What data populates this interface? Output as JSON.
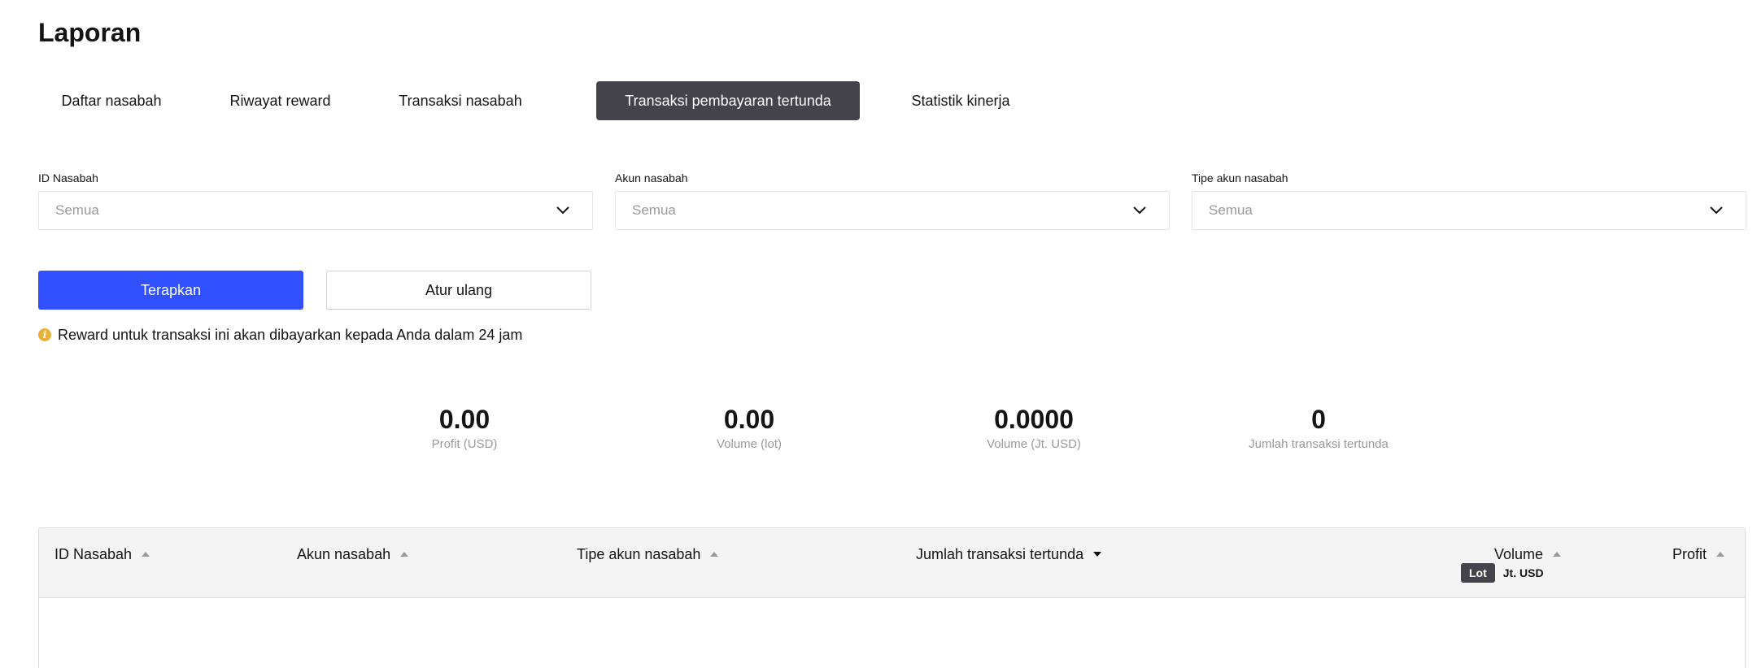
{
  "page": {
    "title": "Laporan"
  },
  "tabs": [
    {
      "label": "Daftar nasabah",
      "active": false
    },
    {
      "label": "Riwayat reward",
      "active": false
    },
    {
      "label": "Transaksi nasabah",
      "active": false
    },
    {
      "label": "Transaksi pembayaran tertunda",
      "active": true
    },
    {
      "label": "Statistik kinerja",
      "active": false
    }
  ],
  "filters": [
    {
      "label": "ID Nasabah",
      "value": "Semua"
    },
    {
      "label": "Akun nasabah",
      "value": "Semua"
    },
    {
      "label": "Tipe akun nasabah",
      "value": "Semua"
    }
  ],
  "actions": {
    "apply_label": "Terapkan",
    "reset_label": "Atur ulang"
  },
  "notice": {
    "icon": "info-icon",
    "text": "Reward untuk transaksi ini akan dibayarkan kepada Anda dalam 24 jam"
  },
  "stats": [
    {
      "value": "0.00",
      "label": "Profit (USD)"
    },
    {
      "value": "0.00",
      "label": "Volume (lot)"
    },
    {
      "value": "0.0000",
      "label": "Volume (Jt. USD)"
    },
    {
      "value": "0",
      "label": "Jumlah transaksi tertunda"
    }
  ],
  "table": {
    "columns": [
      {
        "label": "ID Nasabah",
        "sort": "asc"
      },
      {
        "label": "Akun nasabah",
        "sort": "asc"
      },
      {
        "label": "Tipe akun nasabah",
        "sort": "asc"
      },
      {
        "label": "Jumlah transaksi tertunda",
        "sort": "desc"
      },
      {
        "label": "Volume",
        "sort": "asc"
      },
      {
        "label": "Profit",
        "sort": "asc"
      }
    ],
    "volume_units": [
      {
        "label": "Lot",
        "active": true
      },
      {
        "label": "Jt. USD",
        "active": false
      }
    ],
    "rows": []
  },
  "colors": {
    "primary": "#3150ff",
    "active_tab": "#44424a",
    "notice_icon": "#e8b13a"
  }
}
